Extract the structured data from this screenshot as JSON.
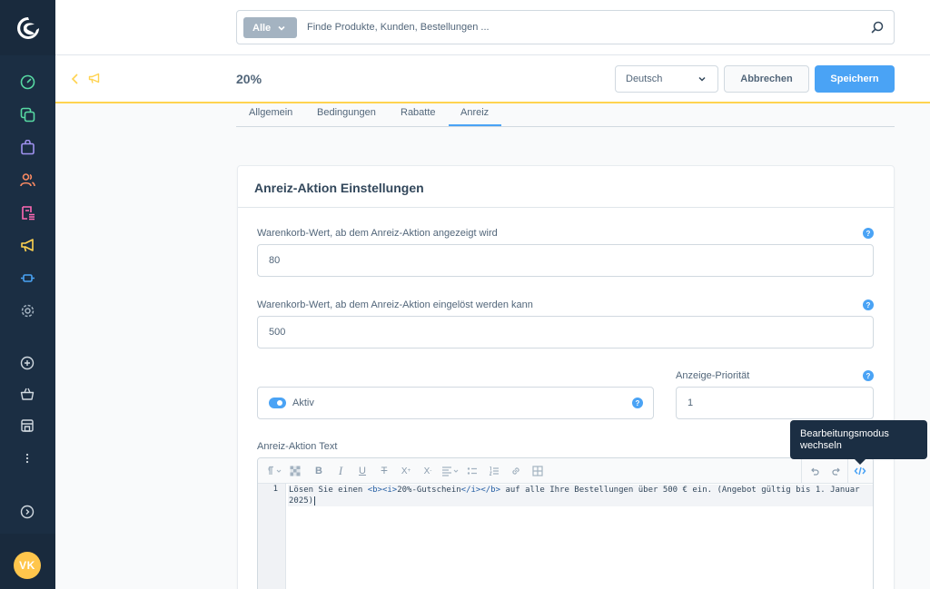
{
  "user": {
    "initials": "VK"
  },
  "colors": {
    "primary": "#4aa3f5",
    "sidebar": "#1b2e43",
    "avatar": "#ffc64c",
    "accent_border": "#ffd350"
  },
  "search": {
    "type_label": "Alle",
    "placeholder": "Finde Produkte, Kunden, Bestellungen ..."
  },
  "header": {
    "title": "20%",
    "language": "Deutsch",
    "cancel_label": "Abbrechen",
    "save_label": "Speichern"
  },
  "tabs": [
    "Allgemein",
    "Bedingungen",
    "Rabatte",
    "Anreiz"
  ],
  "active_tab": "Anreiz",
  "card": {
    "title": "Anreiz-Aktion Einstellungen",
    "display_value_label": "Warenkorb-Wert, ab dem Anreiz-Aktion angezeigt wird",
    "display_value": "80",
    "redeem_value_label": "Warenkorb-Wert, ab dem Anreiz-Aktion eingelöst werden kann",
    "redeem_value": "500",
    "active_label": "Aktiv",
    "active": true,
    "priority_label": "Anzeige-Priorität",
    "priority_value": "1",
    "text_label": "Anreiz-Aktion Text",
    "help_glyph": "?"
  },
  "editor": {
    "line_number": "1",
    "code_before": "Lösen Sie einen ",
    "tag_open": "<b><i>",
    "code_middle": "20%-Gutschein",
    "tag_close": "</i></b>",
    "code_after": " auf alle Ihre Bestellungen über 500 € ein. (Angebot gültig bis 1. Januar 2025)"
  },
  "tooltip": {
    "text": "Bearbeitungsmodus wechseln"
  },
  "icons": {
    "sidebar": [
      "dashboard-icon",
      "catalogue-icon",
      "orders-icon",
      "customers-icon",
      "content-icon",
      "marketing-icon",
      "extensions-icon",
      "settings-icon",
      "add-icon",
      "shop-basket-icon",
      "sales-channel-icon",
      "more-icon",
      "expand-icon"
    ]
  }
}
